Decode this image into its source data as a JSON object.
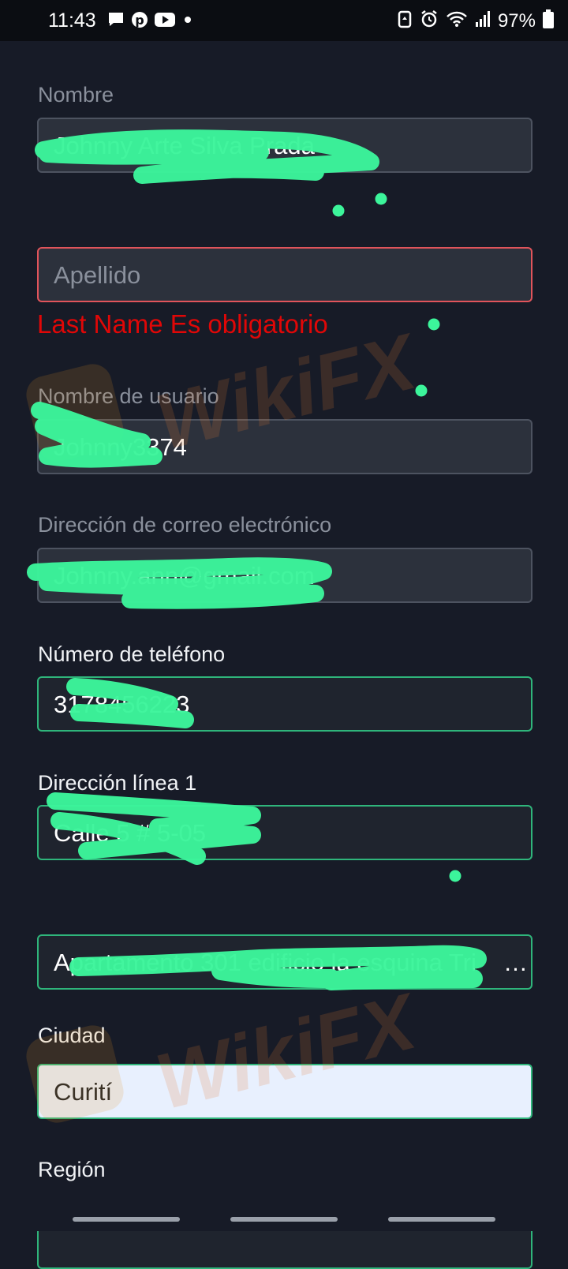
{
  "status_bar": {
    "time": "11:43",
    "battery": "97%",
    "left_icons": [
      "chat-icon",
      "pinterest-icon",
      "youtube-icon",
      "dot-icon"
    ],
    "right_icons": [
      "data-saver-icon",
      "alarm-icon",
      "wifi-icon",
      "signal-icon",
      "battery-icon"
    ]
  },
  "form": {
    "nombre": {
      "label": "Nombre",
      "value": "Johnny Arte Silva Prada"
    },
    "apellido": {
      "placeholder": "Apellido",
      "error": "Last Name Es obligatorio"
    },
    "usuario": {
      "label": "Nombre de usuario",
      "value": "Johnny3374"
    },
    "correo": {
      "label": "Dirección de correo electrónico",
      "value": "Johnny.ann@gmail.com"
    },
    "telefono": {
      "label": "Número de teléfono",
      "value": "3178456223"
    },
    "direccion1": {
      "label": "Dirección línea 1",
      "value": "Calle 5 # 5-05"
    },
    "direccion2": {
      "value": "Apartamento 301 edificio la esquina Tri"
    },
    "ciudad": {
      "label": "Ciudad",
      "value": "Curití"
    },
    "region": {
      "label": "Región"
    }
  },
  "watermark": {
    "text": "WikiFX"
  },
  "colors": {
    "background": "#171b27",
    "field_bg": "#2c313c",
    "valid_border": "#2fb57b",
    "error_border": "#e1545b",
    "error_text": "#e00707",
    "scribble": "#3cf59b"
  }
}
